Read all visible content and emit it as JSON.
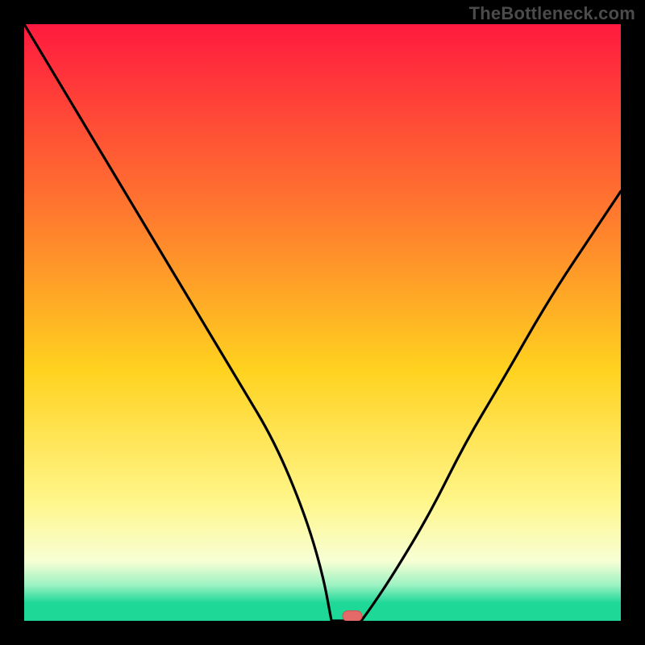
{
  "watermark": "TheBottleneck.com",
  "colors": {
    "top": "#ff1a3f",
    "mid_upper": "#ff7a2e",
    "mid": "#ffd21f",
    "mid_lower": "#fff68a",
    "pale": "#f7ffd4",
    "mint": "#9cf2c2",
    "green": "#1ed898",
    "black": "#000000",
    "curve": "#000000",
    "marker_fill": "#e46a6a",
    "marker_stroke": "#d94f4f"
  },
  "chart_data": {
    "type": "line",
    "title": "",
    "xlabel": "",
    "ylabel": "",
    "xlim": [
      0,
      100
    ],
    "ylim": [
      0,
      100
    ],
    "series": [
      {
        "name": "bottleneck-curve",
        "x": [
          0,
          6,
          12,
          18,
          24,
          30,
          36,
          42,
          47,
          50,
          52,
          54,
          56,
          58,
          62,
          68,
          74,
          80,
          88,
          96,
          100
        ],
        "y": [
          100,
          90,
          80,
          70,
          60,
          50,
          40,
          30,
          18,
          8,
          2,
          0,
          0,
          2,
          8,
          18,
          30,
          40,
          54,
          66,
          72
        ]
      }
    ],
    "marker": {
      "x": 55,
      "y": 0.8
    },
    "flat_segment": {
      "x_start": 51.5,
      "x_end": 56.5,
      "y": 0
    }
  }
}
